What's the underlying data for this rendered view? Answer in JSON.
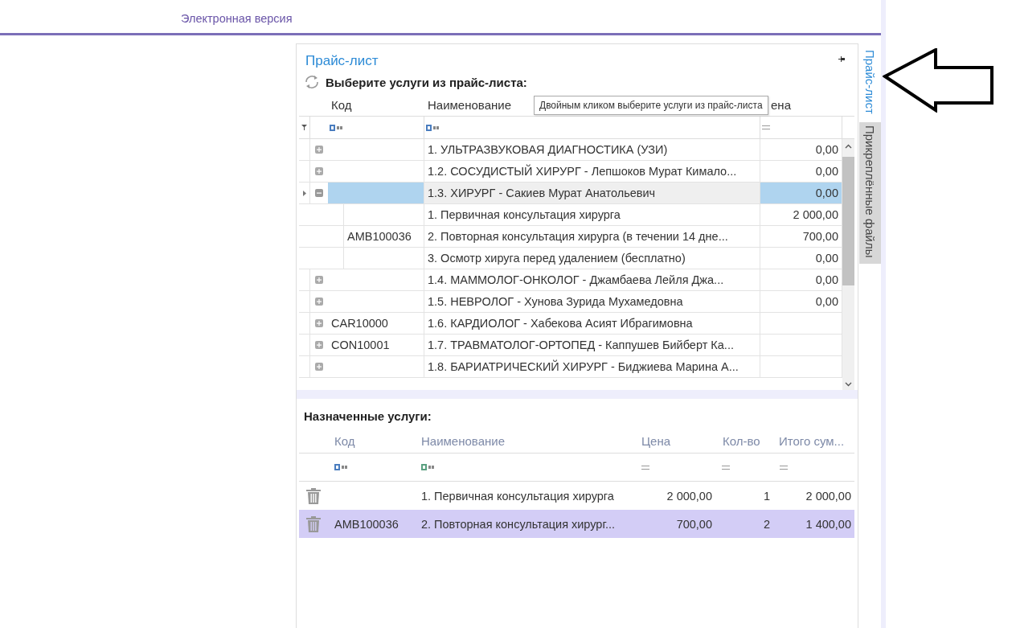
{
  "header": {
    "link": "Электронная версия"
  },
  "panel": {
    "title": "Прайс-лист",
    "subtitle": "Выберите услуги из прайс-листа:"
  },
  "price_table": {
    "columns": [
      "Код",
      "Наименование",
      "ена"
    ],
    "tooltip": "Двойным кликом выберите услуги из прайс-листа",
    "rows": [
      {
        "name": "1. УЛЬТРАЗВУКОВАЯ ДИАГНОСТИКА (УЗИ)",
        "price": "0,00",
        "expanded": false,
        "selected": false
      },
      {
        "name": "1.2. СОСУДИСТЫЙ ХИРУРГ - Лепшоков Мурат Кимало...",
        "price": "0,00",
        "expanded": false,
        "selected": false
      },
      {
        "name": "1.3. ХИРУРГ - Сакиев Мурат Анатольевич",
        "price": "0,00",
        "expanded": true,
        "selected": true,
        "children": [
          {
            "name": "1. Первичная консультация хирурга",
            "price": "2 000,00",
            "selected": false
          },
          {
            "code": "AMB100036",
            "name": "2. Повторная консультация хирурга (в течении 14 дне...",
            "price": "700,00",
            "selected": false
          },
          {
            "name": "3. Осмотр хируга перед удалением (бесплатно)",
            "price": "0,00",
            "selected": false
          }
        ]
      },
      {
        "name": "1.4. МАММОЛОГ-ОНКОЛОГ  - Джамбаева Лейля Джа...",
        "price": "0,00",
        "expanded": false,
        "selected": false
      },
      {
        "name": "1.5. НЕВРОЛОГ - Хунова Зурида Мухамедовна",
        "price": "0,00",
        "expanded": false,
        "selected": false
      },
      {
        "code": "CAR10000",
        "name": "1.6. КАРДИОЛОГ - Хабекова Асият Ибрагимовна",
        "expanded": false,
        "selected": false
      },
      {
        "code": "CON10001",
        "name": "1.7. ТРАВМАТОЛОГ-ОРТОПЕД - Каппушев Бийберт Ка...",
        "expanded": false,
        "selected": false
      },
      {
        "name": "1.8. БАРИАТРИЧЕСКИЙ ХИРУРГ - Биджиева Марина А...",
        "expanded": false,
        "selected": false
      }
    ]
  },
  "assigned": {
    "title": "Назначенные услуги:",
    "columns": [
      "Код",
      "Наименование",
      "Цена",
      "Кол-во",
      "Итого сум..."
    ],
    "rows": [
      {
        "name": "1. Первичная консультация хирурга",
        "price": "2 000,00",
        "qty": "1",
        "total": "2 000,00",
        "selected": false
      },
      {
        "code": "AMB100036",
        "name": "2. Повторная консультация хирург...",
        "price": "700,00",
        "qty": "2",
        "total": "1 400,00",
        "selected": true
      }
    ]
  },
  "side_tabs": [
    {
      "label": "Прайс-лист",
      "selected": true
    },
    {
      "label": "Прикреплённые файлы",
      "selected": false
    }
  ]
}
